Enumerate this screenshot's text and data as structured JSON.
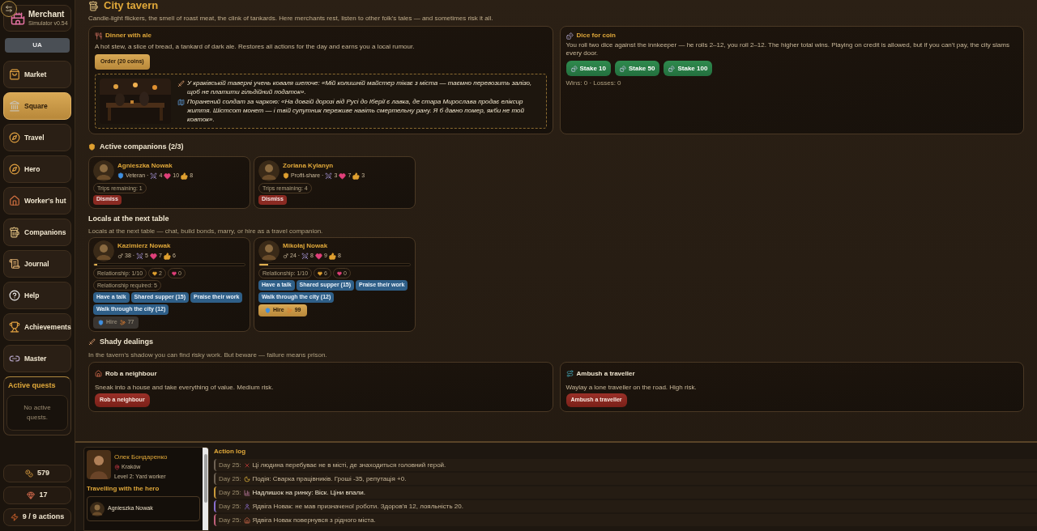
{
  "sidebar": {
    "brand": {
      "title": "Merchant",
      "subtitle": "Simulator v0.54"
    },
    "language": "UA",
    "nav": [
      {
        "label": "Market",
        "selected": false
      },
      {
        "label": "Square",
        "selected": true
      },
      {
        "label": "Travel",
        "selected": false
      },
      {
        "label": "Hero",
        "selected": false
      },
      {
        "label": "Worker's hut",
        "selected": false
      },
      {
        "label": "Companions",
        "selected": false
      },
      {
        "label": "Journal",
        "selected": false
      },
      {
        "label": "Help",
        "selected": false
      },
      {
        "label": "Achievements",
        "selected": false
      },
      {
        "label": "Master",
        "selected": false
      }
    ],
    "quests": {
      "title": "Active quests",
      "empty": "No active quests."
    },
    "stats": [
      "579",
      "17",
      "9 / 9 actions"
    ]
  },
  "tavern": {
    "title": "City tavern",
    "intro": "Candle-light flickers, the smell of roast meat, the clink of tankards. Here merchants rest, listen to other folk's tales — and sometimes risk it all.",
    "dinner": {
      "title": "Dinner with ale",
      "text": "A hot stew, a slice of bread, a tankard of dark ale. Restores all actions for the day and earns you a local rumour.",
      "button": "Order (20 coins)",
      "rumours": [
        "У краківській таверні учень коваля шепоче: «Мій колишній майстер тікає з міста — таємно перевозить залізо, щоб не платити гільдійний податок».",
        "Поранений солдат за чаркою: «На довгій дорозі від Русі до Іберії є лавка, де стара Мирослава продає еліксир життя. Шістсот монет — і твій супутник переживе навіть смертельну рану. Я б давно помер, якби не той ковток»."
      ]
    },
    "dice": {
      "title": "Dice for coin",
      "text": "You roll two dice against the innkeeper — he rolls 2–12, you roll 2–12. The higher total wins. Playing on credit is allowed, but if you can't pay, the city slams every door.",
      "stakes": [
        "Stake 10",
        "Stake 50",
        "Stake 100"
      ],
      "record": "Wins: 0 · Losses: 0"
    },
    "companions": {
      "title": "Active companions (2/3)",
      "items": [
        {
          "name": "Agnieszka Nowak",
          "trait": "Veteran ·",
          "strength": "4",
          "health": "10",
          "loyalty": "8",
          "trips": "Trips remaining: 1",
          "button": "Dismiss"
        },
        {
          "name": "Zoriana Kylanyn",
          "trait": "Profit-share ·",
          "strength": "3",
          "health": "7",
          "loyalty": "3",
          "trips": "Trips remaining: 4",
          "button": "Dismiss"
        }
      ]
    },
    "locals": {
      "title": "Locals at the next table",
      "intro": "Locals at the next table — chat, build bonds, marry, or hire as a travel companion.",
      "items": [
        {
          "name": "Kazimierz Nowak",
          "age": "38 ·",
          "strength": "5",
          "health": "7",
          "loyalty": "6",
          "level": 0.02,
          "chips": [
            {
              "kind": "relationship",
              "text": "Relationship: 1/10"
            },
            {
              "kind": "friendship",
              "text": "2"
            },
            {
              "kind": "romance",
              "text": "0"
            },
            {
              "kind": "requirement",
              "text": "Relationship required: 5"
            }
          ],
          "actions": [
            "Have a talk",
            "Shared supper (15)",
            "Praise their work",
            "Walk through the city (12)"
          ],
          "hire": {
            "label": "Hire",
            "cost": "77",
            "disabled": true
          }
        },
        {
          "name": "Mikołaj Nowak",
          "age": "24 ·",
          "strength": "8",
          "health": "9",
          "loyalty": "8",
          "level": 0.06,
          "chips": [
            {
              "kind": "relationship",
              "text": "Relationship: 1/10"
            },
            {
              "kind": "friendship",
              "text": "6"
            },
            {
              "kind": "romance",
              "text": "0"
            }
          ],
          "actions": [
            "Have a talk",
            "Shared supper (15)",
            "Praise their work",
            "Walk through the city (12)"
          ],
          "hire": {
            "label": "Hire",
            "cost": "99",
            "disabled": false
          }
        }
      ]
    },
    "shady": {
      "title": "Shady dealings",
      "intro": "In the tavern's shadow you can find risky work. But beware — failure means prison.",
      "jobs": [
        {
          "title": "Rob a neighbour",
          "text": "Sneak into a house and take everything of value. Medium risk.",
          "button": "Rob a neighbour"
        },
        {
          "title": "Ambush a traveller",
          "text": "Waylay a lone traveller on the road. High risk.",
          "button": "Ambush a traveller"
        }
      ]
    }
  },
  "hero": {
    "name": "Олек Бондаренко",
    "location": "Kraków",
    "level": "Level 2: Yard worker",
    "travelling_title": "Travelling with the hero",
    "travellers": [
      "Agnieszka Nowak"
    ]
  },
  "log": {
    "title": "Action log",
    "entries": [
      {
        "day": "Day 25:",
        "text": "Ці людина перебуває не в місті, де знаходиться головний герой.",
        "color": "#6e6253"
      },
      {
        "day": "Day 25:",
        "text": "Подія: Сварка працівників. Гроші -35, репутація +0.",
        "color": "#6e6253"
      },
      {
        "day": "Day 25:",
        "text": "Надлишок на ринку: Віск. Ціни впали.",
        "color": "#c99a3a"
      },
      {
        "day": "Day 25:",
        "text": "Ядвіга Новак: не мав призначеної роботи. Здоров'я 12, лояльність 20.",
        "color": "#8a6fd0"
      },
      {
        "day": "Day 25:",
        "text": "Ядвіга Новак повернувся з рідного міста.",
        "color": "#c0607a"
      }
    ]
  }
}
